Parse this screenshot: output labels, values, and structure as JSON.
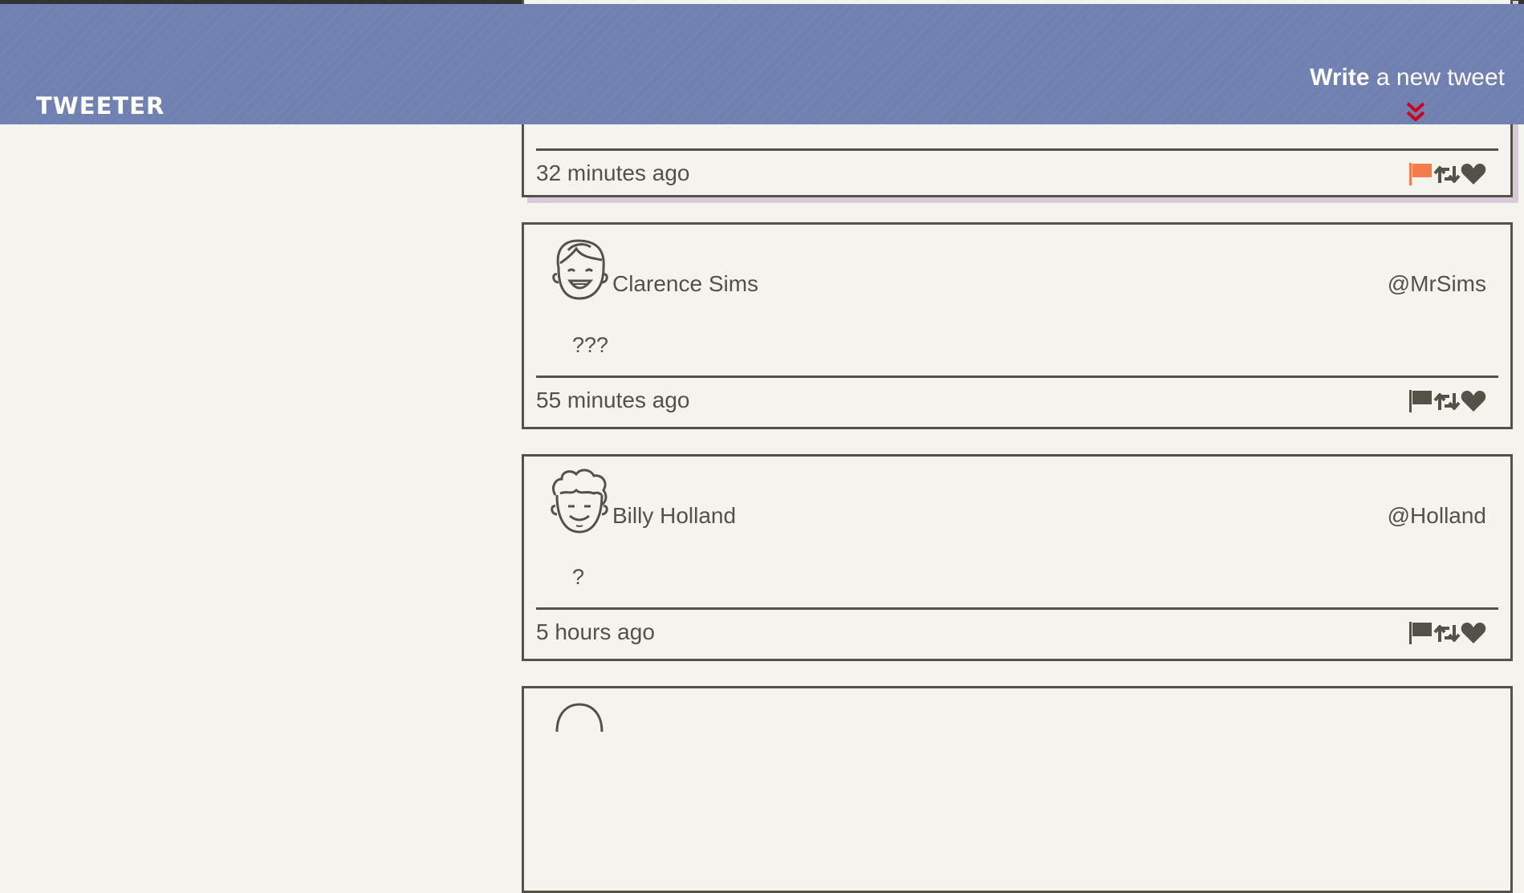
{
  "header": {
    "brand": "TWEETER",
    "compose_bold": "Write",
    "compose_rest": " a new tweet"
  },
  "colors": {
    "header_bg": "#7080b0",
    "page_bg": "#f5f3ee",
    "text": "#545149",
    "flag_active": "#f47c4c",
    "chevron": "#d0021b",
    "hover_shadow": "#d7cbd9"
  },
  "icons": [
    "flag-icon",
    "retweet-icon",
    "heart-icon",
    "chevron-double-down-icon",
    "avatar-icon"
  ],
  "tweets": [
    {
      "name": "",
      "handle": "",
      "content": "",
      "time": "32 minutes ago",
      "flag_active": true,
      "partial": "top"
    },
    {
      "name": "Clarence Sims",
      "handle": "@MrSims",
      "content": "???",
      "time": "55 minutes ago",
      "flag_active": false
    },
    {
      "name": "Billy Holland",
      "handle": "@Holland",
      "content": "?",
      "time": "5 hours ago",
      "flag_active": false
    },
    {
      "name": "",
      "handle": "",
      "content": "",
      "time": "",
      "flag_active": false,
      "partial": "bottom"
    }
  ]
}
